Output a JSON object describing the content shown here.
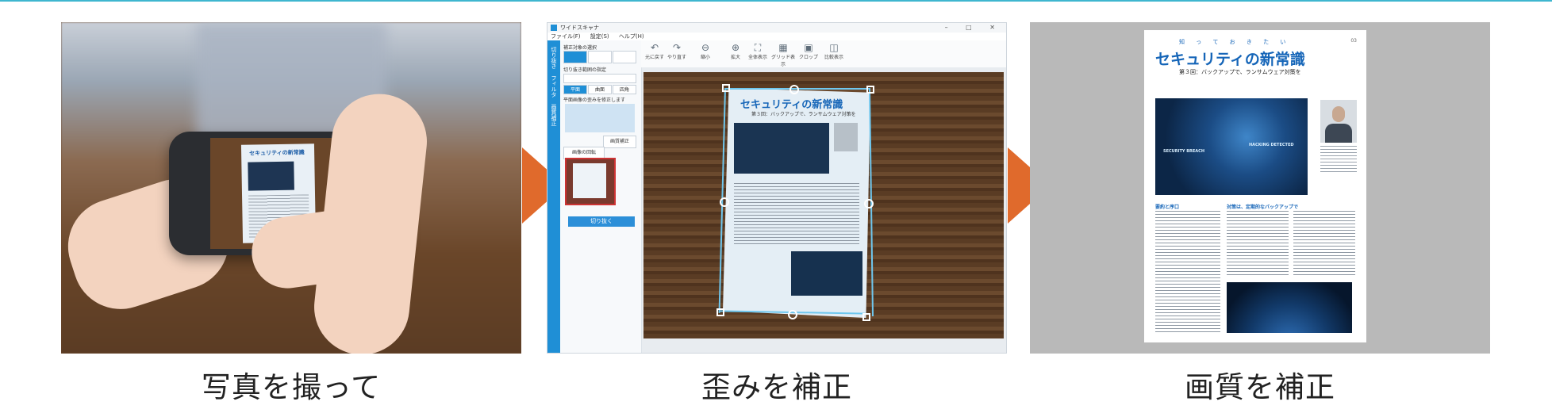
{
  "steps": [
    {
      "caption": "写真を撮って"
    },
    {
      "caption": "歪みを補正"
    },
    {
      "caption": "画質を補正"
    }
  ],
  "phone_doc_title": "セキュリティの新常識",
  "app": {
    "window_title": "ワイドスキャナ",
    "menu": [
      "ファイル(F)",
      "設定(S)",
      "ヘルプ(H)"
    ],
    "toolbar": [
      "元に戻す",
      "やり直す",
      "縮小",
      "拡大",
      "全体表示",
      "グリッド表示",
      "クロップ",
      "比較表示"
    ],
    "left_panel": {
      "section1": "補正対象の選択",
      "section2": "切り抜き範囲の指定",
      "modes": [
        "平面",
        "曲面",
        "四角"
      ],
      "hint": "平面画像の歪みを修正します",
      "auto_label": "画質補正",
      "rotate_label": "画像の回転",
      "cut_button": "切り抜く"
    },
    "sidebar_tabs": [
      "切り抜き",
      "フィルタ",
      "画質補正"
    ]
  },
  "document": {
    "kicker": "知 っ て お き た い",
    "title": "セキュリティの新常識",
    "subtitle": "第３回：バックアップで、ランサムウェア対策を",
    "img_labels": [
      "SECURITY BREACH",
      "HACKING DETECTED"
    ],
    "heading1": "要約と序口",
    "heading2": "対策は、定期的なバックアップで",
    "page_no": "03"
  },
  "colors": {
    "accent_arrow": "#e06a2c",
    "title_blue": "#1565b8",
    "app_blue": "#1f8fd6"
  }
}
